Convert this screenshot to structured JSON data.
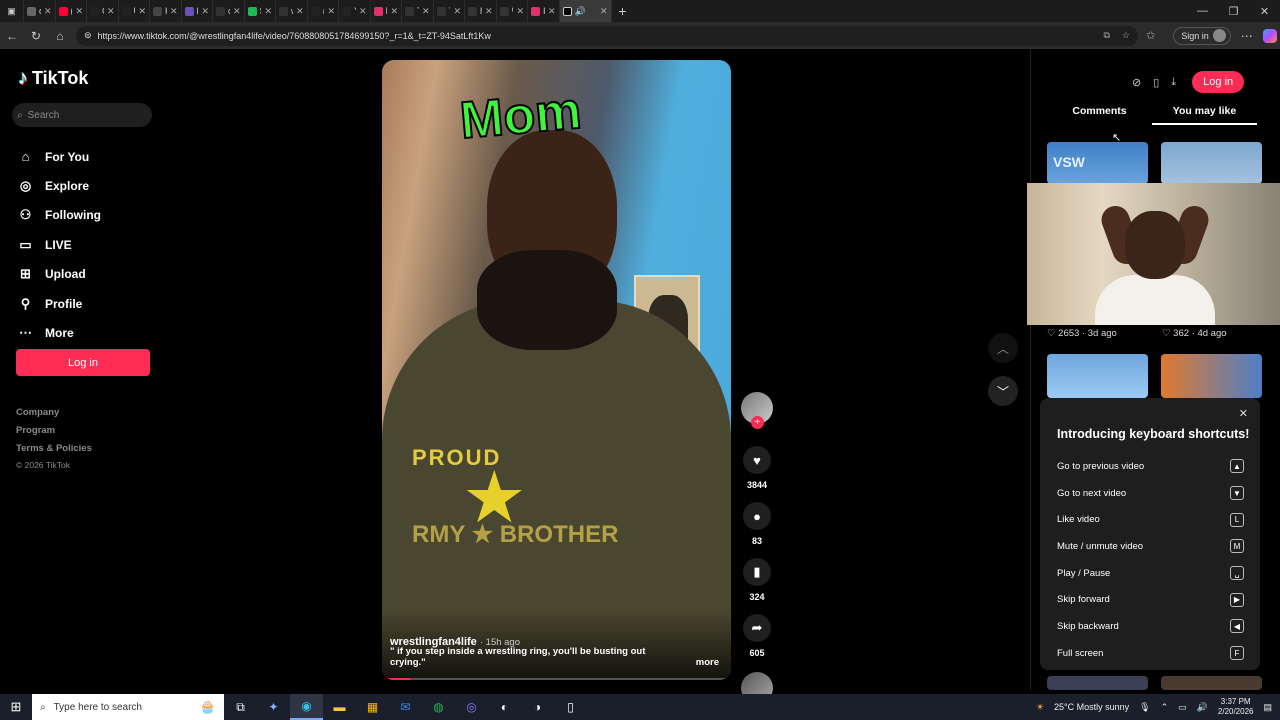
{
  "browser": {
    "tabs": [
      {
        "title": "dean",
        "color": "#666666"
      },
      {
        "title": "(62) P",
        "color": "#ff0033"
      },
      {
        "title": "Celeb",
        "color": "#222222"
      },
      {
        "title": "Ultim",
        "color": "#222222"
      },
      {
        "title": "Home",
        "color": "#444444"
      },
      {
        "title": "Los",
        "color": "#6b4fbb"
      },
      {
        "title": "cuwk",
        "color": "#333333"
      },
      {
        "title": "Strea",
        "color": "#1db954"
      },
      {
        "title": "waD",
        "color": "#333333"
      },
      {
        "title": "#nba",
        "color": "#222222"
      },
      {
        "title": "Yana'",
        "color": "#222222"
      },
      {
        "title": "Insta",
        "color": "#e1306c"
      },
      {
        "title": "Tappe",
        "color": "#333333"
      },
      {
        "title": "Tappe",
        "color": "#333333"
      },
      {
        "title": "holot",
        "color": "#333333"
      },
      {
        "title": "Wost",
        "color": "#333333"
      },
      {
        "title": "Insta",
        "color": "#e1306c"
      }
    ],
    "url": "https://www.tiktok.com/@wrestlingfan4life/video/7608808051784699150?_r=1&_t=ZT-94SatLft1Kw",
    "signin_label": "Sign in"
  },
  "sidebar": {
    "logo": "TikTok",
    "search_placeholder": "Search",
    "items": [
      {
        "label": "For You",
        "icon": "home-icon"
      },
      {
        "label": "Explore",
        "icon": "compass-icon"
      },
      {
        "label": "Following",
        "icon": "following-icon"
      },
      {
        "label": "LIVE",
        "icon": "live-icon"
      },
      {
        "label": "Upload",
        "icon": "upload-icon"
      },
      {
        "label": "Profile",
        "icon": "profile-icon"
      },
      {
        "label": "More",
        "icon": "more-icon"
      }
    ],
    "login_label": "Log in",
    "footer": [
      "Company",
      "Program",
      "Terms & Policies"
    ],
    "copyright": "© 2026 TikTok"
  },
  "video": {
    "overlay_text": "Mom",
    "author": "wrestlingfan4life",
    "posted": "· 15h ago",
    "caption": "\" if you step inside a wrestling ring, you'll be busting out crying.\"",
    "more_label": "more",
    "progress": 0.08,
    "shirt_top": "PROUD",
    "shirt_mid": "RMY ★ BROTHER"
  },
  "actions": {
    "likes": "3844",
    "comments": "83",
    "saves": "324",
    "shares": "605"
  },
  "right_panel": {
    "login_label": "Log in",
    "tabs": [
      "Comments",
      "You may like"
    ],
    "active_tab": "You may like",
    "thumb1_meta": "♡ 2653 · 3d ago",
    "thumb2_meta": "♡ 362 · 4d ago",
    "thumb1_text": "VSW"
  },
  "shortcuts": {
    "title": "Introducing keyboard shortcuts!",
    "rows": [
      {
        "label": "Go to previous video",
        "key": "▲"
      },
      {
        "label": "Go to next video",
        "key": "▼"
      },
      {
        "label": "Like video",
        "key": "L"
      },
      {
        "label": "Mute / unmute video",
        "key": "M"
      },
      {
        "label": "Play / Pause",
        "key": "␣"
      },
      {
        "label": "Skip forward",
        "key": "▶"
      },
      {
        "label": "Skip backward",
        "key": "◀"
      },
      {
        "label": "Full screen",
        "key": "F"
      }
    ]
  },
  "taskbar": {
    "search_placeholder": "Type here to search",
    "weather": "25°C  Mostly sunny",
    "time": "3:37 PM",
    "date": "2/20/2026"
  }
}
